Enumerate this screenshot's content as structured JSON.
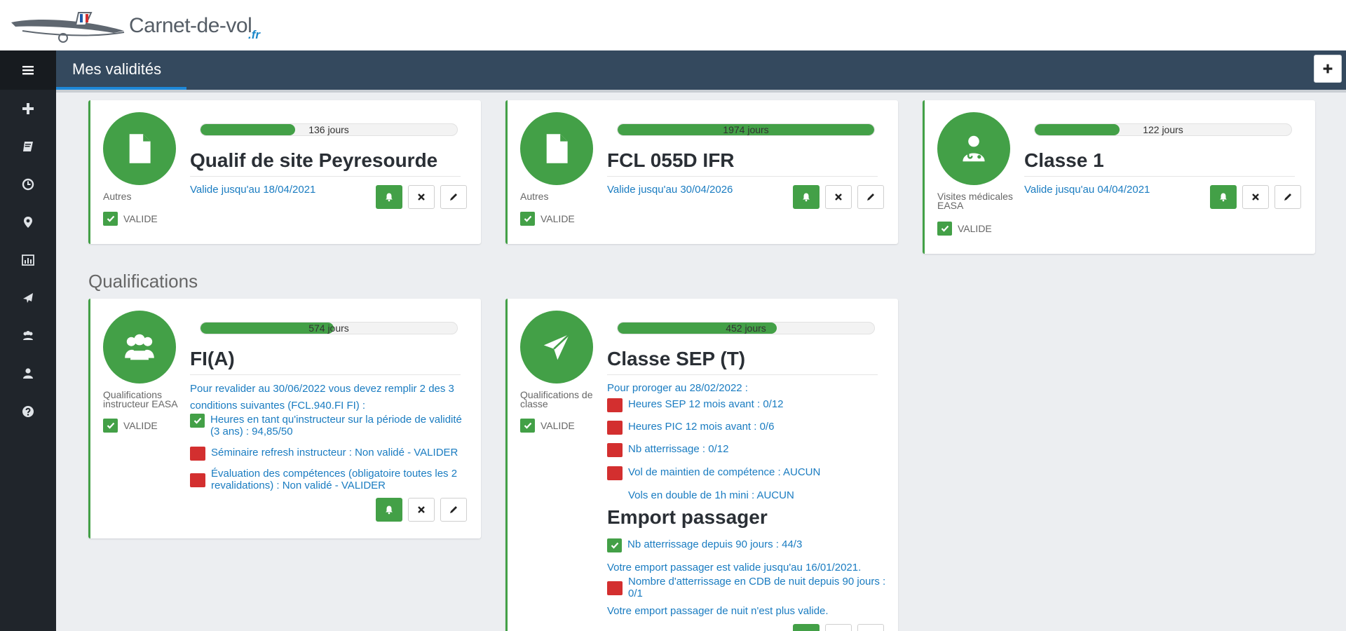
{
  "brand": {
    "name": "Carnet-de-vol",
    "tld": ".fr"
  },
  "header": {
    "title": "Mes validités",
    "add_icon": "plus-icon"
  },
  "sidebar": {
    "toggle_icon": "menu-icon",
    "items": [
      {
        "icon": "plus-icon"
      },
      {
        "icon": "book-icon"
      },
      {
        "icon": "clock-icon"
      },
      {
        "icon": "map-marker-icon"
      },
      {
        "icon": "bar-chart-icon"
      },
      {
        "icon": "plane-icon"
      },
      {
        "icon": "users-icon"
      },
      {
        "icon": "user-icon"
      },
      {
        "icon": "help-icon"
      }
    ]
  },
  "colors": {
    "accent": "#43a047",
    "link": "#1a7cc1",
    "danger": "#d32f2f",
    "header": "#34495e",
    "sidebar": "#20252b"
  },
  "cards_top": [
    {
      "category": "Autres",
      "icon": "document-icon",
      "progress_label": "136 jours",
      "progress_pct": 0.37,
      "name": "Qualif de site Peyresourde",
      "expiry": "Valide jusqu'au 18/04/2021",
      "status": "VALIDE"
    },
    {
      "category": "Autres",
      "icon": "document-icon",
      "progress_label": "1974 jours",
      "progress_pct": 1.0,
      "name": "FCL 055D IFR",
      "expiry": "Valide jusqu'au 30/04/2026",
      "status": "VALIDE"
    },
    {
      "category": "Visites médicales EASA",
      "icon": "doctor-icon",
      "progress_label": "122 jours",
      "progress_pct": 0.33,
      "name": "Classe 1",
      "expiry": "Valide jusqu'au 04/04/2021",
      "status": "VALIDE"
    }
  ],
  "section_title": "Qualifications",
  "fia": {
    "category": "Qualifications instructeur EASA",
    "icon": "users-icon",
    "progress_label": "574 jours",
    "progress_pct": 0.52,
    "name": "FI(A)",
    "intro": "Pour revalider au 30/06/2022 vous devez remplir 2 des 3 conditions suivantes (FCL.940.FI FI) :",
    "conditions": [
      {
        "ok": true,
        "text": "Heures en tant qu'instructeur sur la période de validité (3 ans) : 94,85/50"
      },
      {
        "ok": false,
        "text": "Séminaire refresh instructeur : Non validé - VALIDER"
      },
      {
        "ok": false,
        "text": "Évaluation des compétences (obligatoire toutes les 2 revalidations) : Non validé - VALIDER"
      }
    ],
    "status": "VALIDE"
  },
  "sep": {
    "category": "Qualifications de classe",
    "icon": "paper-plane-icon",
    "progress_label": "452 jours",
    "progress_pct": 0.62,
    "name": "Classe SEP (T)",
    "intro": "Pour proroger au 28/02/2022 :",
    "conditions": [
      {
        "ok": false,
        "text": "Heures SEP 12 mois avant : 0/12"
      },
      {
        "ok": false,
        "text": "Heures PIC 12 mois avant : 0/6"
      },
      {
        "ok": false,
        "text": "Nb atterrissage : 0/12"
      },
      {
        "ok": false,
        "text": "Vol de maintien de compétence : AUCUN"
      }
    ],
    "double": "Vols en double de 1h mini : AUCUN",
    "sub_title": "Emport passager",
    "passenger": {
      "ok": true,
      "text": "Nb atterrissage depuis 90 jours : 44/3"
    },
    "passenger_valid": "Votre emport passager est valide jusqu'au 16/01/2021.",
    "night": {
      "ok": false,
      "text": "Nombre d'atterrissage en CDB de nuit depuis 90 jours : 0/1"
    },
    "night_invalid": "Votre emport passager de nuit n'est plus valide.",
    "status": "VALIDE"
  }
}
